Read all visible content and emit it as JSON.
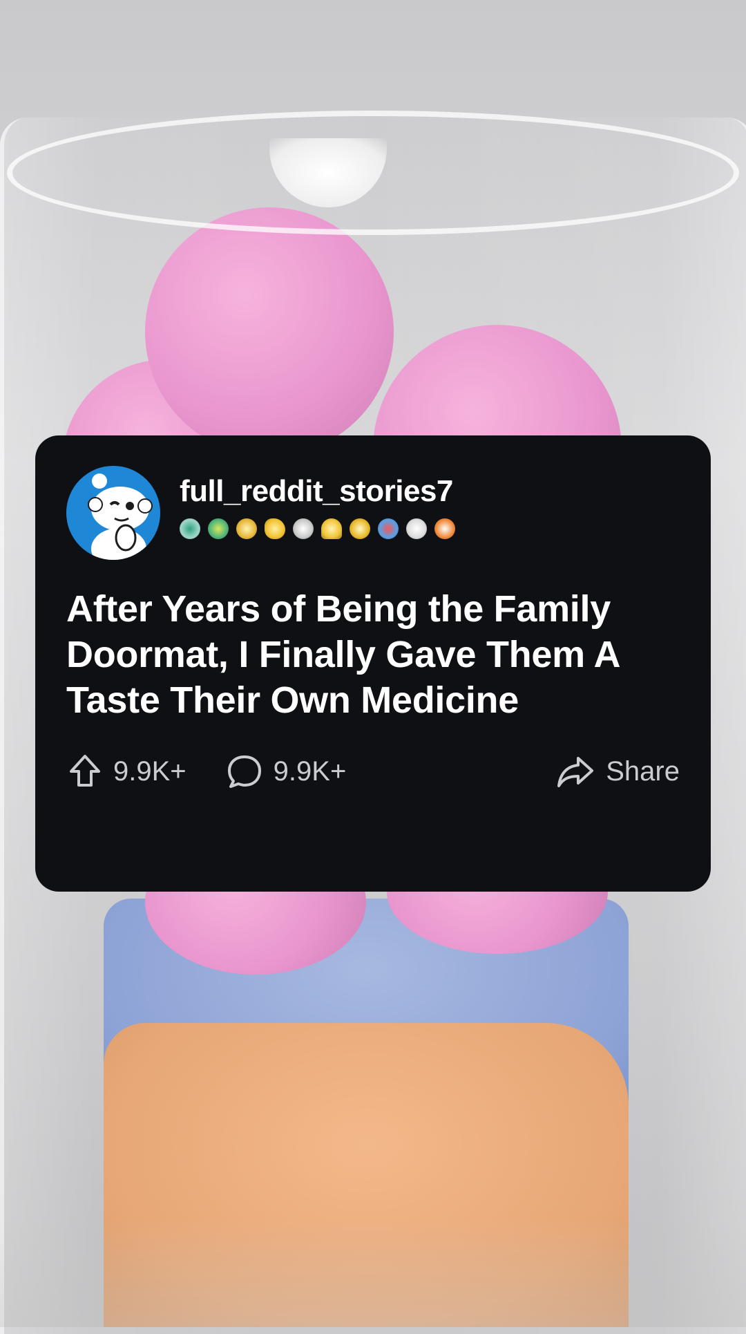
{
  "post": {
    "username": "full_reddit_stories7",
    "title": "After Years of Being the Family Doormat, I Finally Gave Them A Taste Their Own Medicine",
    "upvotes": "9.9K+",
    "comments": "9.9K+",
    "share_label": "Share"
  },
  "badges": [
    {
      "icon": "silver-medal-icon",
      "color": "#9fd6c9"
    },
    {
      "icon": "clover-icon",
      "color": "#4fb57a"
    },
    {
      "icon": "star-badge-icon",
      "color": "#e6b73b"
    },
    {
      "icon": "banana-icon",
      "color": "#f1c232"
    },
    {
      "icon": "handshake-icon",
      "color": "#c9c9c9"
    },
    {
      "icon": "gold-pyramid-icon",
      "color": "#f0c53a"
    },
    {
      "icon": "trophy-icon",
      "color": "#e8b829"
    },
    {
      "icon": "plus-one-icon",
      "color": "#5aa0e6"
    },
    {
      "icon": "clapping-hands-icon",
      "color": "#dcdcdc"
    },
    {
      "icon": "rocket-like-icon",
      "color": "#f08a3a"
    }
  ],
  "colors": {
    "card_bg": "#0f1013",
    "avatar_bg": "#1e88d6",
    "action_text": "#c9ccd1"
  }
}
